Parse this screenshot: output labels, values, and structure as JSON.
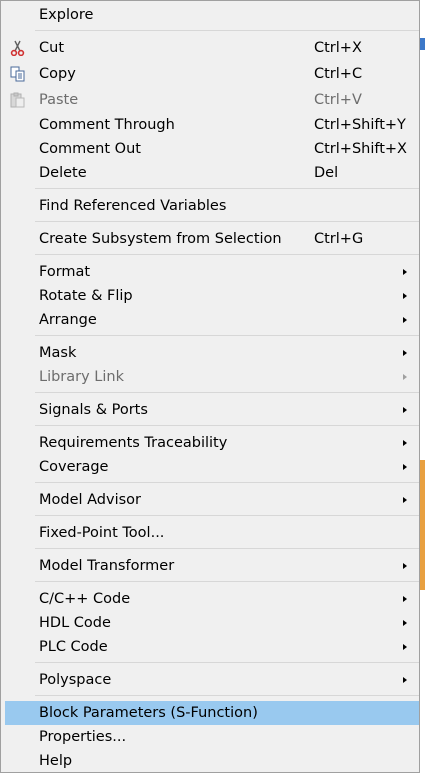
{
  "colors": {
    "menu_background": "#f0f0f0",
    "highlight": "#99c9ef",
    "disabled_text": "#6d6d6d",
    "separator": "#d7d7d7"
  },
  "menu": {
    "explore": {
      "label": "Explore"
    },
    "cut": {
      "label": "Cut",
      "shortcut": "Ctrl+X",
      "icon": "scissors-icon"
    },
    "copy": {
      "label": "Copy",
      "shortcut": "Ctrl+C",
      "icon": "copy-icon"
    },
    "paste": {
      "label": "Paste",
      "shortcut": "Ctrl+V",
      "icon": "paste-icon",
      "disabled": true
    },
    "comment_through": {
      "label": "Comment Through",
      "shortcut": "Ctrl+Shift+Y"
    },
    "comment_out": {
      "label": "Comment Out",
      "shortcut": "Ctrl+Shift+X"
    },
    "delete": {
      "label": "Delete",
      "shortcut": "Del"
    },
    "find_referenced_variables": {
      "label": "Find Referenced Variables"
    },
    "create_subsystem": {
      "label": "Create Subsystem from Selection",
      "shortcut": "Ctrl+G"
    },
    "format": {
      "label": "Format",
      "submenu": true
    },
    "rotate_flip": {
      "label": "Rotate & Flip",
      "submenu": true
    },
    "arrange": {
      "label": "Arrange",
      "submenu": true
    },
    "mask": {
      "label": "Mask",
      "submenu": true
    },
    "library_link": {
      "label": "Library Link",
      "submenu": true,
      "disabled": true
    },
    "signals_ports": {
      "label": "Signals & Ports",
      "submenu": true
    },
    "requirements_traceability": {
      "label": "Requirements Traceability",
      "submenu": true
    },
    "coverage": {
      "label": "Coverage",
      "submenu": true
    },
    "model_advisor": {
      "label": "Model Advisor",
      "submenu": true
    },
    "fixed_point_tool": {
      "label": "Fixed-Point Tool..."
    },
    "model_transformer": {
      "label": "Model Transformer",
      "submenu": true
    },
    "c_cpp_code": {
      "label": "C/C++ Code",
      "submenu": true
    },
    "hdl_code": {
      "label": "HDL Code",
      "submenu": true
    },
    "plc_code": {
      "label": "PLC Code",
      "submenu": true
    },
    "polyspace": {
      "label": "Polyspace",
      "submenu": true
    },
    "block_parameters": {
      "label": "Block Parameters (S-Function)",
      "highlighted": true
    },
    "properties": {
      "label": "Properties..."
    },
    "help": {
      "label": "Help"
    }
  }
}
